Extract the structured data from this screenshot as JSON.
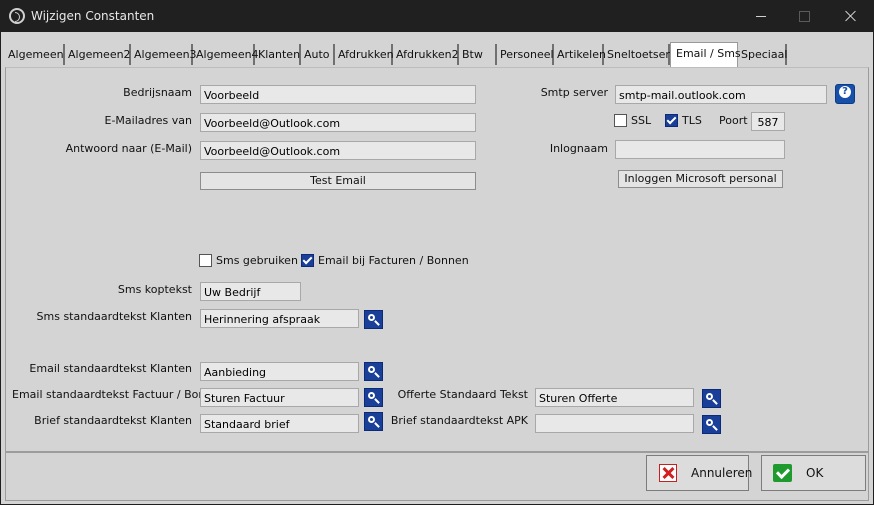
{
  "window": {
    "title": "Wijzigen Constanten"
  },
  "tabs": [
    "Algemeen",
    "Algemeen2",
    "Algemeen3",
    "Algemeen4",
    "Klanten",
    "Auto",
    "Afdrukken",
    "Afdrukken2",
    "Btw",
    "Personeel",
    "Artikelen",
    "Sneltoetsen",
    "Email / Sms",
    "Speciaal"
  ],
  "active_tab": "Email / Sms",
  "email": {
    "bedrijfsnaam_label": "Bedrijsnaam",
    "bedrijfsnaam_value": "Voorbeeld",
    "emailadres_label": "E-Mailadres van",
    "emailadres_value": "Voorbeeld@Outlook.com",
    "antwoord_label": "Antwoord naar (E-Mail)",
    "antwoord_value": "Voorbeeld@Outlook.com",
    "test_button": "Test Email"
  },
  "smtp": {
    "server_label": "Smtp server",
    "server_value": "smtp-mail.outlook.com",
    "ssl_label": "SSL",
    "ssl_checked": false,
    "tls_label": "TLS",
    "tls_checked": true,
    "poort_label": "Poort",
    "poort_value": "587",
    "inlognaam_label": "Inlognaam",
    "inlognaam_value": "",
    "login_button": "Inloggen Microsoft personal"
  },
  "sms": {
    "gebruiken_label": "Sms gebruiken",
    "gebruiken_checked": false,
    "email_facturen_label": "Email bij Facturen / Bonnen",
    "email_facturen_checked": true,
    "koptekst_label": "Sms koptekst",
    "koptekst_value": "Uw Bedrijf",
    "standaard_label": "Sms standaardtekst Klanten",
    "standaard_value": "Herinnering afspraak"
  },
  "templates": {
    "email_klanten_label": "Email standaardtekst Klanten",
    "email_klanten_value": "Aanbieding",
    "email_factuur_label": "Email standaardtekst Factuur / Bon",
    "email_factuur_value": "Sturen Factuur",
    "brief_klanten_label": "Brief standaardtekst Klanten",
    "brief_klanten_value": "Standaard brief",
    "offerte_label": "Offerte Standaard Tekst",
    "offerte_value": "Sturen Offerte",
    "brief_apk_label": "Brief standaardtekst APK",
    "brief_apk_value": ""
  },
  "footer": {
    "cancel": "Annuleren",
    "ok": "OK"
  }
}
